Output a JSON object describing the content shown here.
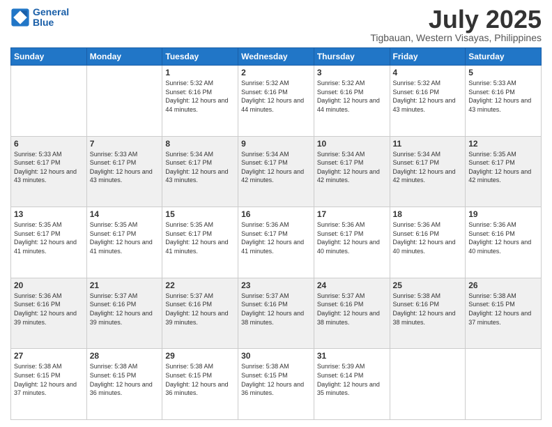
{
  "logo": {
    "line1": "General",
    "line2": "Blue"
  },
  "title": "July 2025",
  "subtitle": "Tigbauan, Western Visayas, Philippines",
  "days_of_week": [
    "Sunday",
    "Monday",
    "Tuesday",
    "Wednesday",
    "Thursday",
    "Friday",
    "Saturday"
  ],
  "weeks": [
    [
      {
        "day": "",
        "sunrise": "",
        "sunset": "",
        "daylight": ""
      },
      {
        "day": "",
        "sunrise": "",
        "sunset": "",
        "daylight": ""
      },
      {
        "day": "1",
        "sunrise": "Sunrise: 5:32 AM",
        "sunset": "Sunset: 6:16 PM",
        "daylight": "Daylight: 12 hours and 44 minutes."
      },
      {
        "day": "2",
        "sunrise": "Sunrise: 5:32 AM",
        "sunset": "Sunset: 6:16 PM",
        "daylight": "Daylight: 12 hours and 44 minutes."
      },
      {
        "day": "3",
        "sunrise": "Sunrise: 5:32 AM",
        "sunset": "Sunset: 6:16 PM",
        "daylight": "Daylight: 12 hours and 44 minutes."
      },
      {
        "day": "4",
        "sunrise": "Sunrise: 5:32 AM",
        "sunset": "Sunset: 6:16 PM",
        "daylight": "Daylight: 12 hours and 43 minutes."
      },
      {
        "day": "5",
        "sunrise": "Sunrise: 5:33 AM",
        "sunset": "Sunset: 6:16 PM",
        "daylight": "Daylight: 12 hours and 43 minutes."
      }
    ],
    [
      {
        "day": "6",
        "sunrise": "Sunrise: 5:33 AM",
        "sunset": "Sunset: 6:17 PM",
        "daylight": "Daylight: 12 hours and 43 minutes."
      },
      {
        "day": "7",
        "sunrise": "Sunrise: 5:33 AM",
        "sunset": "Sunset: 6:17 PM",
        "daylight": "Daylight: 12 hours and 43 minutes."
      },
      {
        "day": "8",
        "sunrise": "Sunrise: 5:34 AM",
        "sunset": "Sunset: 6:17 PM",
        "daylight": "Daylight: 12 hours and 43 minutes."
      },
      {
        "day": "9",
        "sunrise": "Sunrise: 5:34 AM",
        "sunset": "Sunset: 6:17 PM",
        "daylight": "Daylight: 12 hours and 42 minutes."
      },
      {
        "day": "10",
        "sunrise": "Sunrise: 5:34 AM",
        "sunset": "Sunset: 6:17 PM",
        "daylight": "Daylight: 12 hours and 42 minutes."
      },
      {
        "day": "11",
        "sunrise": "Sunrise: 5:34 AM",
        "sunset": "Sunset: 6:17 PM",
        "daylight": "Daylight: 12 hours and 42 minutes."
      },
      {
        "day": "12",
        "sunrise": "Sunrise: 5:35 AM",
        "sunset": "Sunset: 6:17 PM",
        "daylight": "Daylight: 12 hours and 42 minutes."
      }
    ],
    [
      {
        "day": "13",
        "sunrise": "Sunrise: 5:35 AM",
        "sunset": "Sunset: 6:17 PM",
        "daylight": "Daylight: 12 hours and 41 minutes."
      },
      {
        "day": "14",
        "sunrise": "Sunrise: 5:35 AM",
        "sunset": "Sunset: 6:17 PM",
        "daylight": "Daylight: 12 hours and 41 minutes."
      },
      {
        "day": "15",
        "sunrise": "Sunrise: 5:35 AM",
        "sunset": "Sunset: 6:17 PM",
        "daylight": "Daylight: 12 hours and 41 minutes."
      },
      {
        "day": "16",
        "sunrise": "Sunrise: 5:36 AM",
        "sunset": "Sunset: 6:17 PM",
        "daylight": "Daylight: 12 hours and 41 minutes."
      },
      {
        "day": "17",
        "sunrise": "Sunrise: 5:36 AM",
        "sunset": "Sunset: 6:17 PM",
        "daylight": "Daylight: 12 hours and 40 minutes."
      },
      {
        "day": "18",
        "sunrise": "Sunrise: 5:36 AM",
        "sunset": "Sunset: 6:16 PM",
        "daylight": "Daylight: 12 hours and 40 minutes."
      },
      {
        "day": "19",
        "sunrise": "Sunrise: 5:36 AM",
        "sunset": "Sunset: 6:16 PM",
        "daylight": "Daylight: 12 hours and 40 minutes."
      }
    ],
    [
      {
        "day": "20",
        "sunrise": "Sunrise: 5:36 AM",
        "sunset": "Sunset: 6:16 PM",
        "daylight": "Daylight: 12 hours and 39 minutes."
      },
      {
        "day": "21",
        "sunrise": "Sunrise: 5:37 AM",
        "sunset": "Sunset: 6:16 PM",
        "daylight": "Daylight: 12 hours and 39 minutes."
      },
      {
        "day": "22",
        "sunrise": "Sunrise: 5:37 AM",
        "sunset": "Sunset: 6:16 PM",
        "daylight": "Daylight: 12 hours and 39 minutes."
      },
      {
        "day": "23",
        "sunrise": "Sunrise: 5:37 AM",
        "sunset": "Sunset: 6:16 PM",
        "daylight": "Daylight: 12 hours and 38 minutes."
      },
      {
        "day": "24",
        "sunrise": "Sunrise: 5:37 AM",
        "sunset": "Sunset: 6:16 PM",
        "daylight": "Daylight: 12 hours and 38 minutes."
      },
      {
        "day": "25",
        "sunrise": "Sunrise: 5:38 AM",
        "sunset": "Sunset: 6:16 PM",
        "daylight": "Daylight: 12 hours and 38 minutes."
      },
      {
        "day": "26",
        "sunrise": "Sunrise: 5:38 AM",
        "sunset": "Sunset: 6:15 PM",
        "daylight": "Daylight: 12 hours and 37 minutes."
      }
    ],
    [
      {
        "day": "27",
        "sunrise": "Sunrise: 5:38 AM",
        "sunset": "Sunset: 6:15 PM",
        "daylight": "Daylight: 12 hours and 37 minutes."
      },
      {
        "day": "28",
        "sunrise": "Sunrise: 5:38 AM",
        "sunset": "Sunset: 6:15 PM",
        "daylight": "Daylight: 12 hours and 36 minutes."
      },
      {
        "day": "29",
        "sunrise": "Sunrise: 5:38 AM",
        "sunset": "Sunset: 6:15 PM",
        "daylight": "Daylight: 12 hours and 36 minutes."
      },
      {
        "day": "30",
        "sunrise": "Sunrise: 5:38 AM",
        "sunset": "Sunset: 6:15 PM",
        "daylight": "Daylight: 12 hours and 36 minutes."
      },
      {
        "day": "31",
        "sunrise": "Sunrise: 5:39 AM",
        "sunset": "Sunset: 6:14 PM",
        "daylight": "Daylight: 12 hours and 35 minutes."
      },
      {
        "day": "",
        "sunrise": "",
        "sunset": "",
        "daylight": ""
      },
      {
        "day": "",
        "sunrise": "",
        "sunset": "",
        "daylight": ""
      }
    ]
  ]
}
